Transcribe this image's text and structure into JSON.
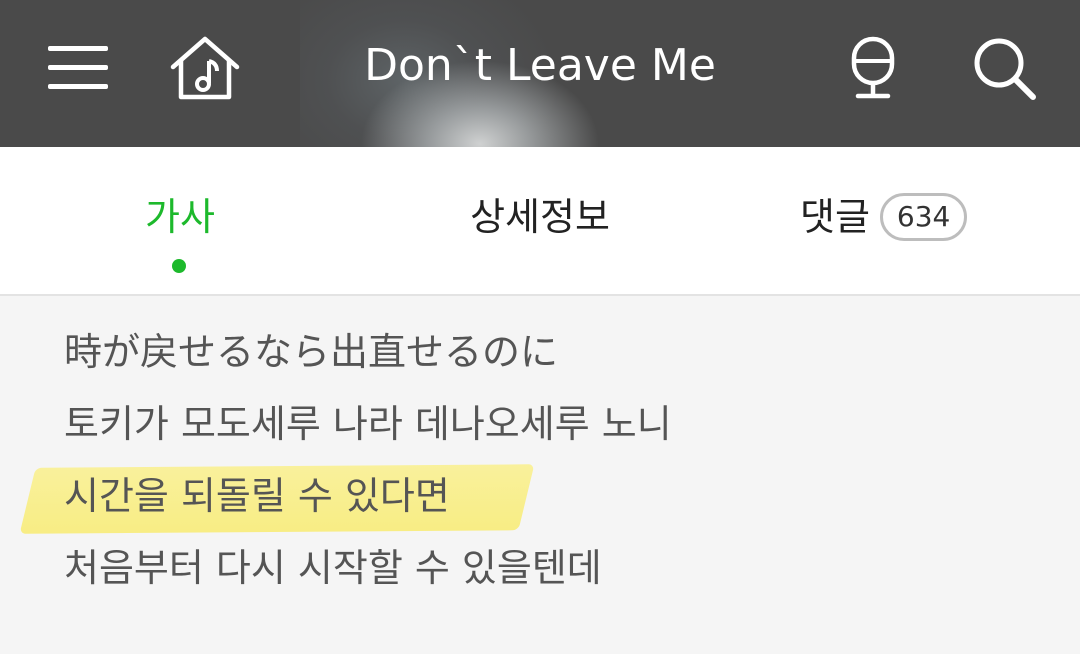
{
  "header": {
    "title": "Don`t Leave Me",
    "background_color": "#4a4a4a",
    "icons": [
      "menu-icon",
      "home-music-icon",
      "microphone-icon",
      "search-icon"
    ]
  },
  "tabs": [
    {
      "label": "가사",
      "active": true
    },
    {
      "label": "상세정보",
      "active": false
    },
    {
      "label": "댓글",
      "count": "634",
      "active": false
    }
  ],
  "accent_color": "#1db92c",
  "highlight_color": "#f8ec78",
  "lyrics": [
    "時が戻せるなら出直せるのに",
    "토키가 모도세루 나라 데나오세루 노니",
    "시간을 되돌릴 수 있다면",
    "처음부터 다시 시작할 수 있을텐데"
  ]
}
